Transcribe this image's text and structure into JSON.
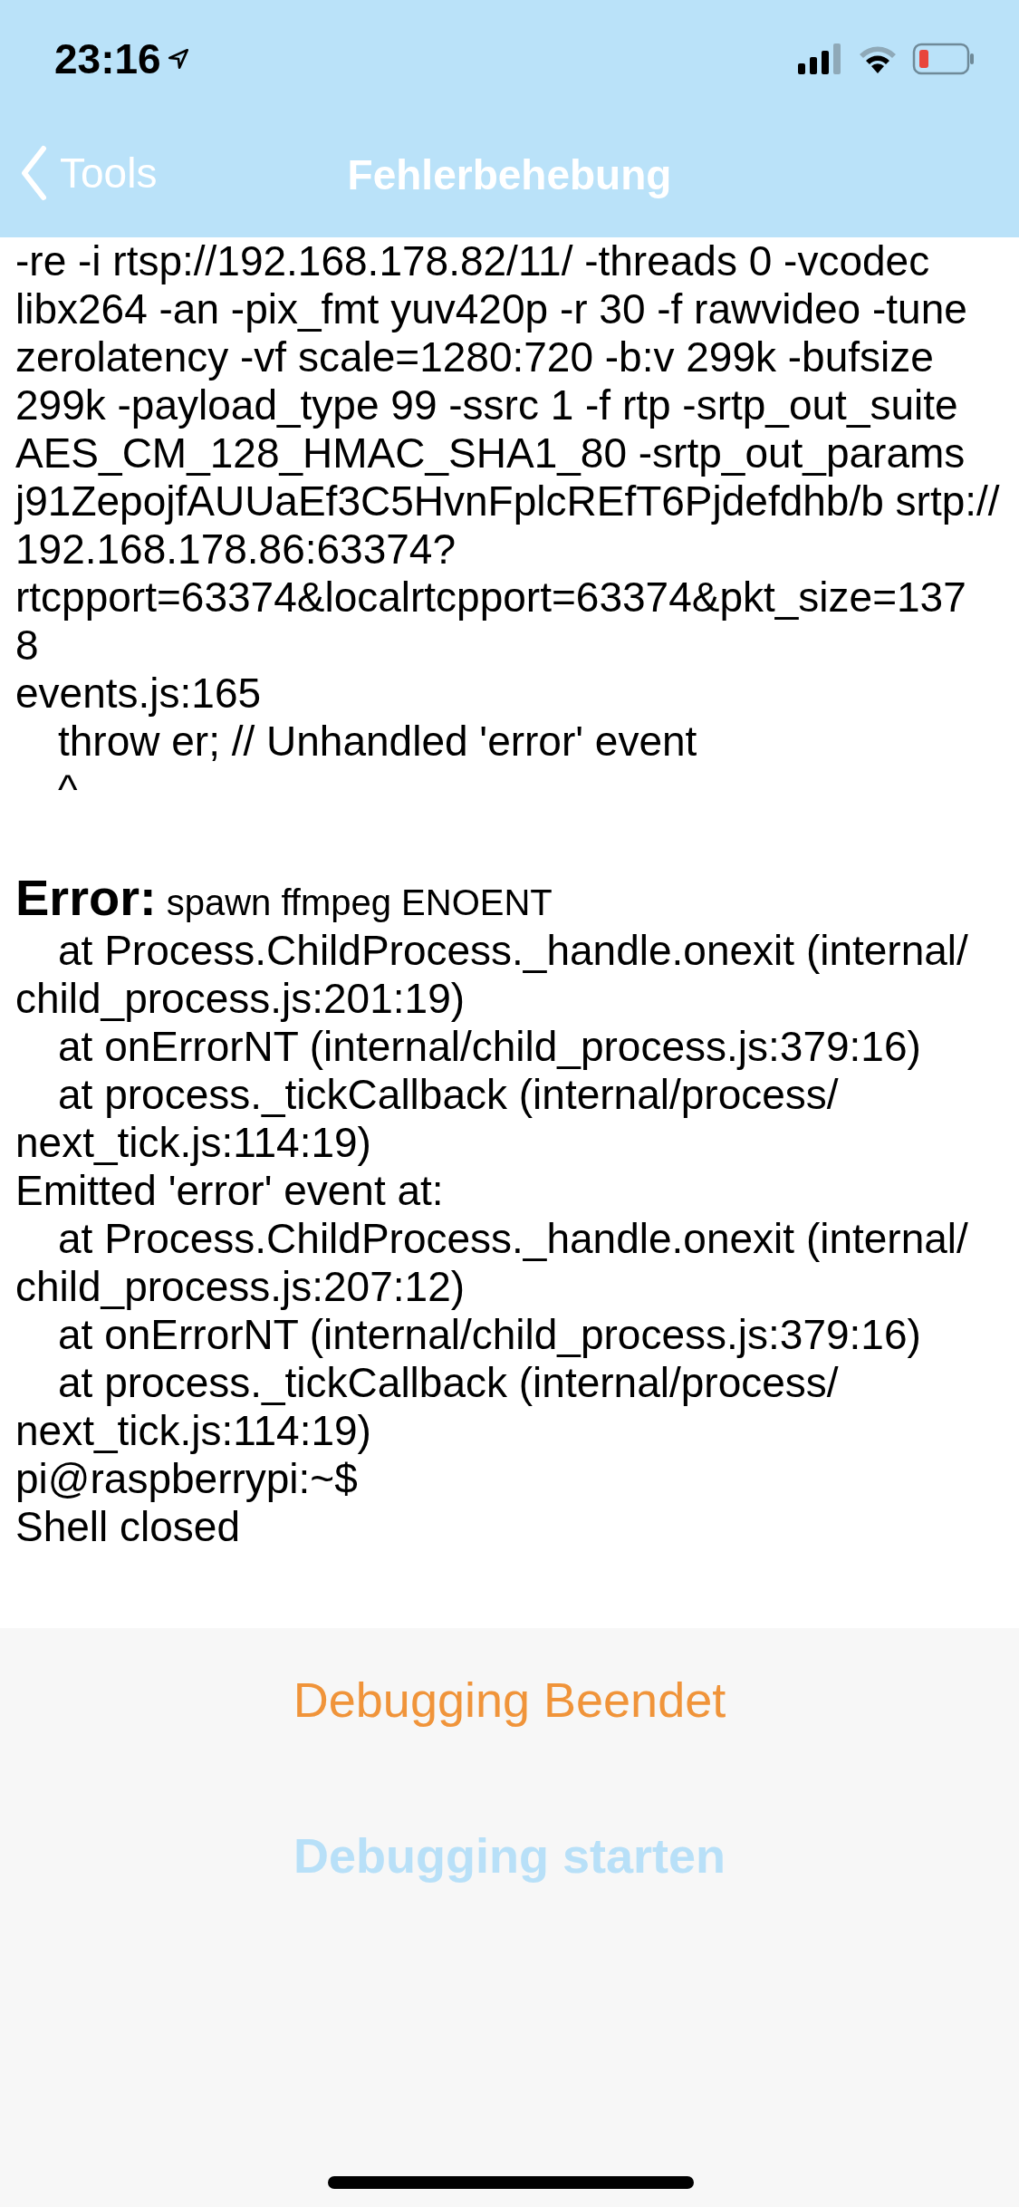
{
  "status_bar": {
    "time": "23:16"
  },
  "nav": {
    "back": "Tools",
    "title": "Fehlerbehebung"
  },
  "log": [
    {
      "kind": "line",
      "indent": false,
      "text": "-re -i rtsp://192.168.178.82/11/ -threads 0 -vcodec"
    },
    {
      "kind": "line",
      "indent": false,
      "text": "libx264 -an -pix_fmt yuv420p -r 30 -f rawvideo -tune"
    },
    {
      "kind": "line",
      "indent": false,
      "text": "zerolatency -vf scale=1280:720 -b:v 299k -bufsize"
    },
    {
      "kind": "line",
      "indent": false,
      "text": "299k -payload_type 99 -ssrc 1 -f rtp -srtp_out_suite"
    },
    {
      "kind": "line",
      "indent": false,
      "text": "AES_CM_128_HMAC_SHA1_80 -srtp_out_params"
    },
    {
      "kind": "line",
      "indent": false,
      "text": "j91ZepojfAUUaEf3C5HvnFplcREfT6Pjdefdhb/b srtp://"
    },
    {
      "kind": "line",
      "indent": false,
      "text": "192.168.178.86:63374?"
    },
    {
      "kind": "line",
      "indent": false,
      "text": "rtcpport=63374&localrtcpport=63374&pkt_size=137"
    },
    {
      "kind": "line",
      "indent": false,
      "text": "8"
    },
    {
      "kind": "line",
      "indent": false,
      "text": "events.js:165"
    },
    {
      "kind": "line",
      "indent": true,
      "text": "throw er; // Unhandled 'error' event"
    },
    {
      "kind": "line",
      "indent": true,
      "text": "^"
    },
    {
      "kind": "heading",
      "indent": false,
      "text": "**Error:** spawn ffmpeg ENOENT"
    },
    {
      "kind": "line",
      "indent": true,
      "text": "at Process.ChildProcess._handle.onexit (internal/"
    },
    {
      "kind": "line",
      "indent": false,
      "text": "child_process.js:201:19)"
    },
    {
      "kind": "line",
      "indent": true,
      "text": "at onErrorNT (internal/child_process.js:379:16)"
    },
    {
      "kind": "line",
      "indent": true,
      "text": "at process._tickCallback (internal/process/"
    },
    {
      "kind": "line",
      "indent": false,
      "text": "next_tick.js:114:19)"
    },
    {
      "kind": "line",
      "indent": false,
      "text": "Emitted 'error' event at:"
    },
    {
      "kind": "line",
      "indent": true,
      "text": "at Process.ChildProcess._handle.onexit (internal/"
    },
    {
      "kind": "line",
      "indent": false,
      "text": "child_process.js:207:12)"
    },
    {
      "kind": "line",
      "indent": true,
      "text": "at onErrorNT (internal/child_process.js:379:16)"
    },
    {
      "kind": "line",
      "indent": true,
      "text": "at process._tickCallback (internal/process/"
    },
    {
      "kind": "line",
      "indent": false,
      "text": "next_tick.js:114:19)"
    },
    {
      "kind": "line",
      "indent": false,
      "text": "pi@raspberrypi:~$"
    },
    {
      "kind": "line",
      "indent": false,
      "text": "Shell closed"
    }
  ],
  "status": "Debugging Beendet",
  "start_button": {
    "label": "Debugging starten",
    "disabled": true
  }
}
